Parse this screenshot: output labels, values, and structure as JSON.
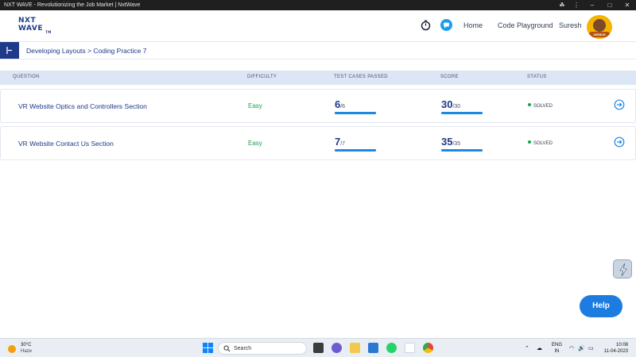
{
  "window": {
    "title": "NXT WAVE - Revolutionizing the Job Market | NxtWave"
  },
  "header": {
    "logo_line1": "NXT",
    "logo_line2": "WAVE",
    "logo_tm": "TM",
    "nav": {
      "home": "Home",
      "code_playground": "Code Playground",
      "user": "Suresh"
    },
    "avatar_badge": "GENIUS",
    "icons": [
      "timer-icon",
      "chat-icon"
    ]
  },
  "breadcrumb": {
    "text": "Developing Layouts > Coding Practice 7"
  },
  "table": {
    "columns": {
      "question": "QUESTION",
      "difficulty": "DIFFICULTY",
      "test_cases": "TEST CASES PASSED",
      "score": "SCORE",
      "status": "STATUS"
    },
    "rows": [
      {
        "question": "VR Website Optics and Controllers Section",
        "difficulty": "Easy",
        "tc_passed": "6",
        "tc_total": "/6",
        "score": "30",
        "score_total": "/30",
        "status": "SOLVED",
        "progress": 1.0
      },
      {
        "question": "VR Website Contact Us Section",
        "difficulty": "Easy",
        "tc_passed": "7",
        "tc_total": "/7",
        "score": "35",
        "score_total": "/35",
        "status": "SOLVED",
        "progress": 1.0
      }
    ]
  },
  "help": {
    "label": "Help"
  },
  "taskbar": {
    "weather_temp": "30°C",
    "weather_desc": "Haze",
    "search_label": "Search",
    "lang_line1": "ENG",
    "lang_line2": "IN",
    "time": "10:08",
    "date": "11-04-2023"
  },
  "colors": {
    "brand": "#1e3a8a",
    "accent": "#1e88e5",
    "easy": "#16a34a",
    "table_header_bg": "#dde6f5"
  }
}
